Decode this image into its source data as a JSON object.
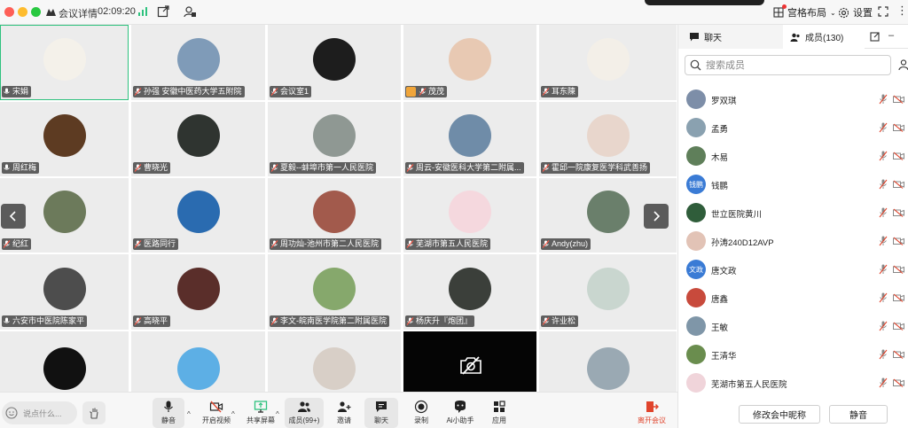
{
  "titlebar": {
    "meeting_title": "会议详情",
    "elapsed": "02:09:20",
    "layout_label": "宫格布局",
    "settings_label": "设置"
  },
  "grid": {
    "tiles": [
      {
        "name": "宋娟",
        "mic": "on",
        "active": true,
        "avatar_color": "#f4f1ea"
      },
      {
        "name": "孙强 安徽中医药大学五附院",
        "mic": "off",
        "avatar_color": "#7f9bb8"
      },
      {
        "name": "会议室1",
        "mic": "off",
        "avatar_color": "#1d1d1d"
      },
      {
        "name": "茂茂",
        "mic": "off",
        "host": true,
        "avatar_color": "#e8c9b3"
      },
      {
        "name": "耳东陳",
        "mic": "off",
        "avatar_color": "#f3efe8"
      },
      {
        "name": "周红梅",
        "mic": "on",
        "avatar_color": "#5d3b22"
      },
      {
        "name": "曹晓光",
        "mic": "off",
        "avatar_color": "#2f3430"
      },
      {
        "name": "夏毅--蚌埠市第一人民医院",
        "mic": "off",
        "avatar_color": "#8f9893"
      },
      {
        "name": "周云-安徽医科大学第二附属...",
        "mic": "off",
        "avatar_color": "#6f8ca8"
      },
      {
        "name": "霍邱一院康复医学科武善扬",
        "mic": "off",
        "avatar_color": "#e8d6cc"
      },
      {
        "name": "纪红",
        "mic": "off",
        "avatar_color": "#6c7a5b"
      },
      {
        "name": "医路同行",
        "mic": "off",
        "avatar_color": "#2a6bb0"
      },
      {
        "name": "周功灿-池州市第二人民医院",
        "mic": "off",
        "avatar_color": "#a25a4c"
      },
      {
        "name": "芜湖市第五人民医院",
        "mic": "off",
        "avatar_color": "#f5d8de"
      },
      {
        "name": "Andy(zhu)",
        "mic": "off",
        "avatar_color": "#6a7f6b"
      },
      {
        "name": "六安市中医院陈家平",
        "mic": "on",
        "avatar_color": "#4d4d4d"
      },
      {
        "name": "高晓平",
        "mic": "off",
        "avatar_color": "#5a2e2a"
      },
      {
        "name": "李文-皖南医学院第二附属医院",
        "mic": "off",
        "avatar_color": "#86a86c"
      },
      {
        "name": "杨庆升『炮团』",
        "mic": "off",
        "avatar_color": "#3b3f3a"
      },
      {
        "name": "许业松",
        "mic": "off",
        "avatar_color": "#c9d6cf"
      },
      {
        "name": "",
        "mic": "off",
        "avatar_color": "#111111"
      },
      {
        "name": "",
        "mic": "off",
        "avatar_color": "#5dafe5"
      },
      {
        "name": "",
        "mic": "off",
        "avatar_color": "#d8cfc7"
      },
      {
        "name": "",
        "mic": "off",
        "black": true
      },
      {
        "name": "",
        "mic": "off",
        "avatar_color": "#9aa9b3"
      }
    ]
  },
  "toolbar": {
    "chat_placeholder": "说点什么...",
    "mute": "静音",
    "video": "开启视频",
    "share": "共享屏幕",
    "members": "成员(99+)",
    "invite": "邀请",
    "chat": "聊天",
    "record": "录制",
    "ai": "Ai小助手",
    "apps": "应用",
    "leave": "离开会议"
  },
  "panel": {
    "tab_chat": "聊天",
    "tab_members": "成员(130)",
    "search_placeholder": "搜索成员",
    "members": [
      {
        "name": "罗双琪",
        "avatar_text": "",
        "avatar_color": "#7d8ea8"
      },
      {
        "name": "孟勇",
        "avatar_text": "",
        "avatar_color": "#8aa1b0"
      },
      {
        "name": "木易",
        "avatar_text": "",
        "avatar_color": "#5f7f5a"
      },
      {
        "name": "钱鹏",
        "avatar_text": "钱鹏",
        "avatar_color": "#3a7bd5"
      },
      {
        "name": "世立医院黄川",
        "avatar_text": "",
        "avatar_color": "#2f5d3a"
      },
      {
        "name": "孙涛240D12AVP",
        "avatar_text": "",
        "avatar_color": "#e2c3b6"
      },
      {
        "name": "唐文政",
        "avatar_text": "文政",
        "avatar_color": "#3a7bd5"
      },
      {
        "name": "唐鑫",
        "avatar_text": "",
        "avatar_color": "#c84a3c"
      },
      {
        "name": "王敏",
        "avatar_text": "",
        "avatar_color": "#7f96a8"
      },
      {
        "name": "王清华",
        "avatar_text": "",
        "avatar_color": "#6a8d4e"
      },
      {
        "name": "芜湖市第五人民医院",
        "avatar_text": "",
        "avatar_color": "#f0d4da"
      }
    ],
    "rename_button": "修改会中昵称",
    "mute_button": "静音"
  },
  "colors": {
    "accent_green": "#2ec27e",
    "leave_red": "#e0442c",
    "host_badge": "#f0a53a"
  }
}
